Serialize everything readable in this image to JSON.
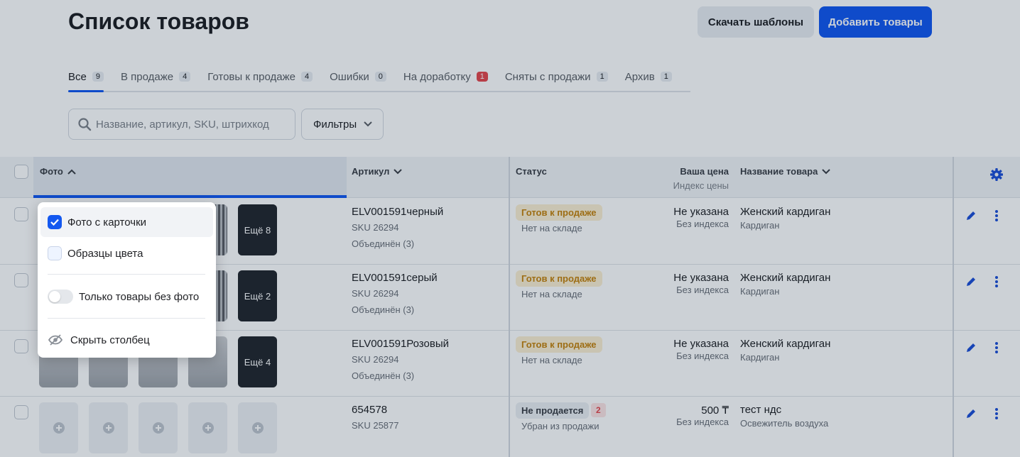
{
  "header": {
    "title": "Список товаров",
    "download_label": "Скачать шаблоны",
    "add_label": "Добавить товары"
  },
  "tabs": [
    {
      "label": "Все",
      "count": "9",
      "active": true
    },
    {
      "label": "В продаже",
      "count": "4"
    },
    {
      "label": "Готовы к продаже",
      "count": "4"
    },
    {
      "label": "Ошибки",
      "count": "0"
    },
    {
      "label": "На доработку",
      "count": "1",
      "alert": true
    },
    {
      "label": "Сняты с продажи",
      "count": "1"
    },
    {
      "label": "Архив",
      "count": "1"
    }
  ],
  "search": {
    "placeholder": "Название, артикул, SKU, штрихкод",
    "value": ""
  },
  "filters": {
    "label": "Фильтры"
  },
  "table": {
    "columns": {
      "photo": "Фото",
      "article": "Артикул",
      "status": "Статус",
      "price": "Ваша цена",
      "price_sub": "Индекс цены",
      "name": "Название товара"
    },
    "rows": [
      {
        "more": "Ещё 8",
        "article": "ELV001591черный",
        "sku": "SKU 26294",
        "merged": "Объединён (3)",
        "status": "Готов к продаже",
        "stock": "Нет на складе",
        "price": "Не указана",
        "index": "Без индекса",
        "name": "Женский кардиган",
        "category": "Кардиган"
      },
      {
        "more": "Ещё 2",
        "article": "ELV001591серый",
        "sku": "SKU 26294",
        "merged": "Объединён (3)",
        "status": "Готов к продаже",
        "stock": "Нет на складе",
        "price": "Не указана",
        "index": "Без индекса",
        "name": "Женский кардиган",
        "category": "Кардиган"
      },
      {
        "more": "Ещё 4",
        "article": "ELV001591Розовый",
        "sku": "SKU 26294",
        "merged": "Объединён (3)",
        "status": "Готов к продаже",
        "stock": "Нет на складе",
        "price": "Не указана",
        "index": "Без индекса",
        "name": "Женский кардиган",
        "category": "Кардиган"
      },
      {
        "article": "654578",
        "sku": "SKU 25877",
        "status": "Не продается",
        "status_count": "2",
        "stock": "Убран из продажи",
        "price": "500 ₸",
        "index": "Без индекса",
        "name": "тест ндс",
        "category": "Освежитель воздуха"
      }
    ]
  },
  "photo_menu": {
    "card_photo": "Фото с карточки",
    "color_samples": "Образцы цвета",
    "no_photo_only": "Только товары без фото",
    "hide_column": "Скрыть столбец"
  },
  "colors": {
    "accent": "#1358f0",
    "warning": "#c5830d",
    "danger": "#e5484d"
  }
}
